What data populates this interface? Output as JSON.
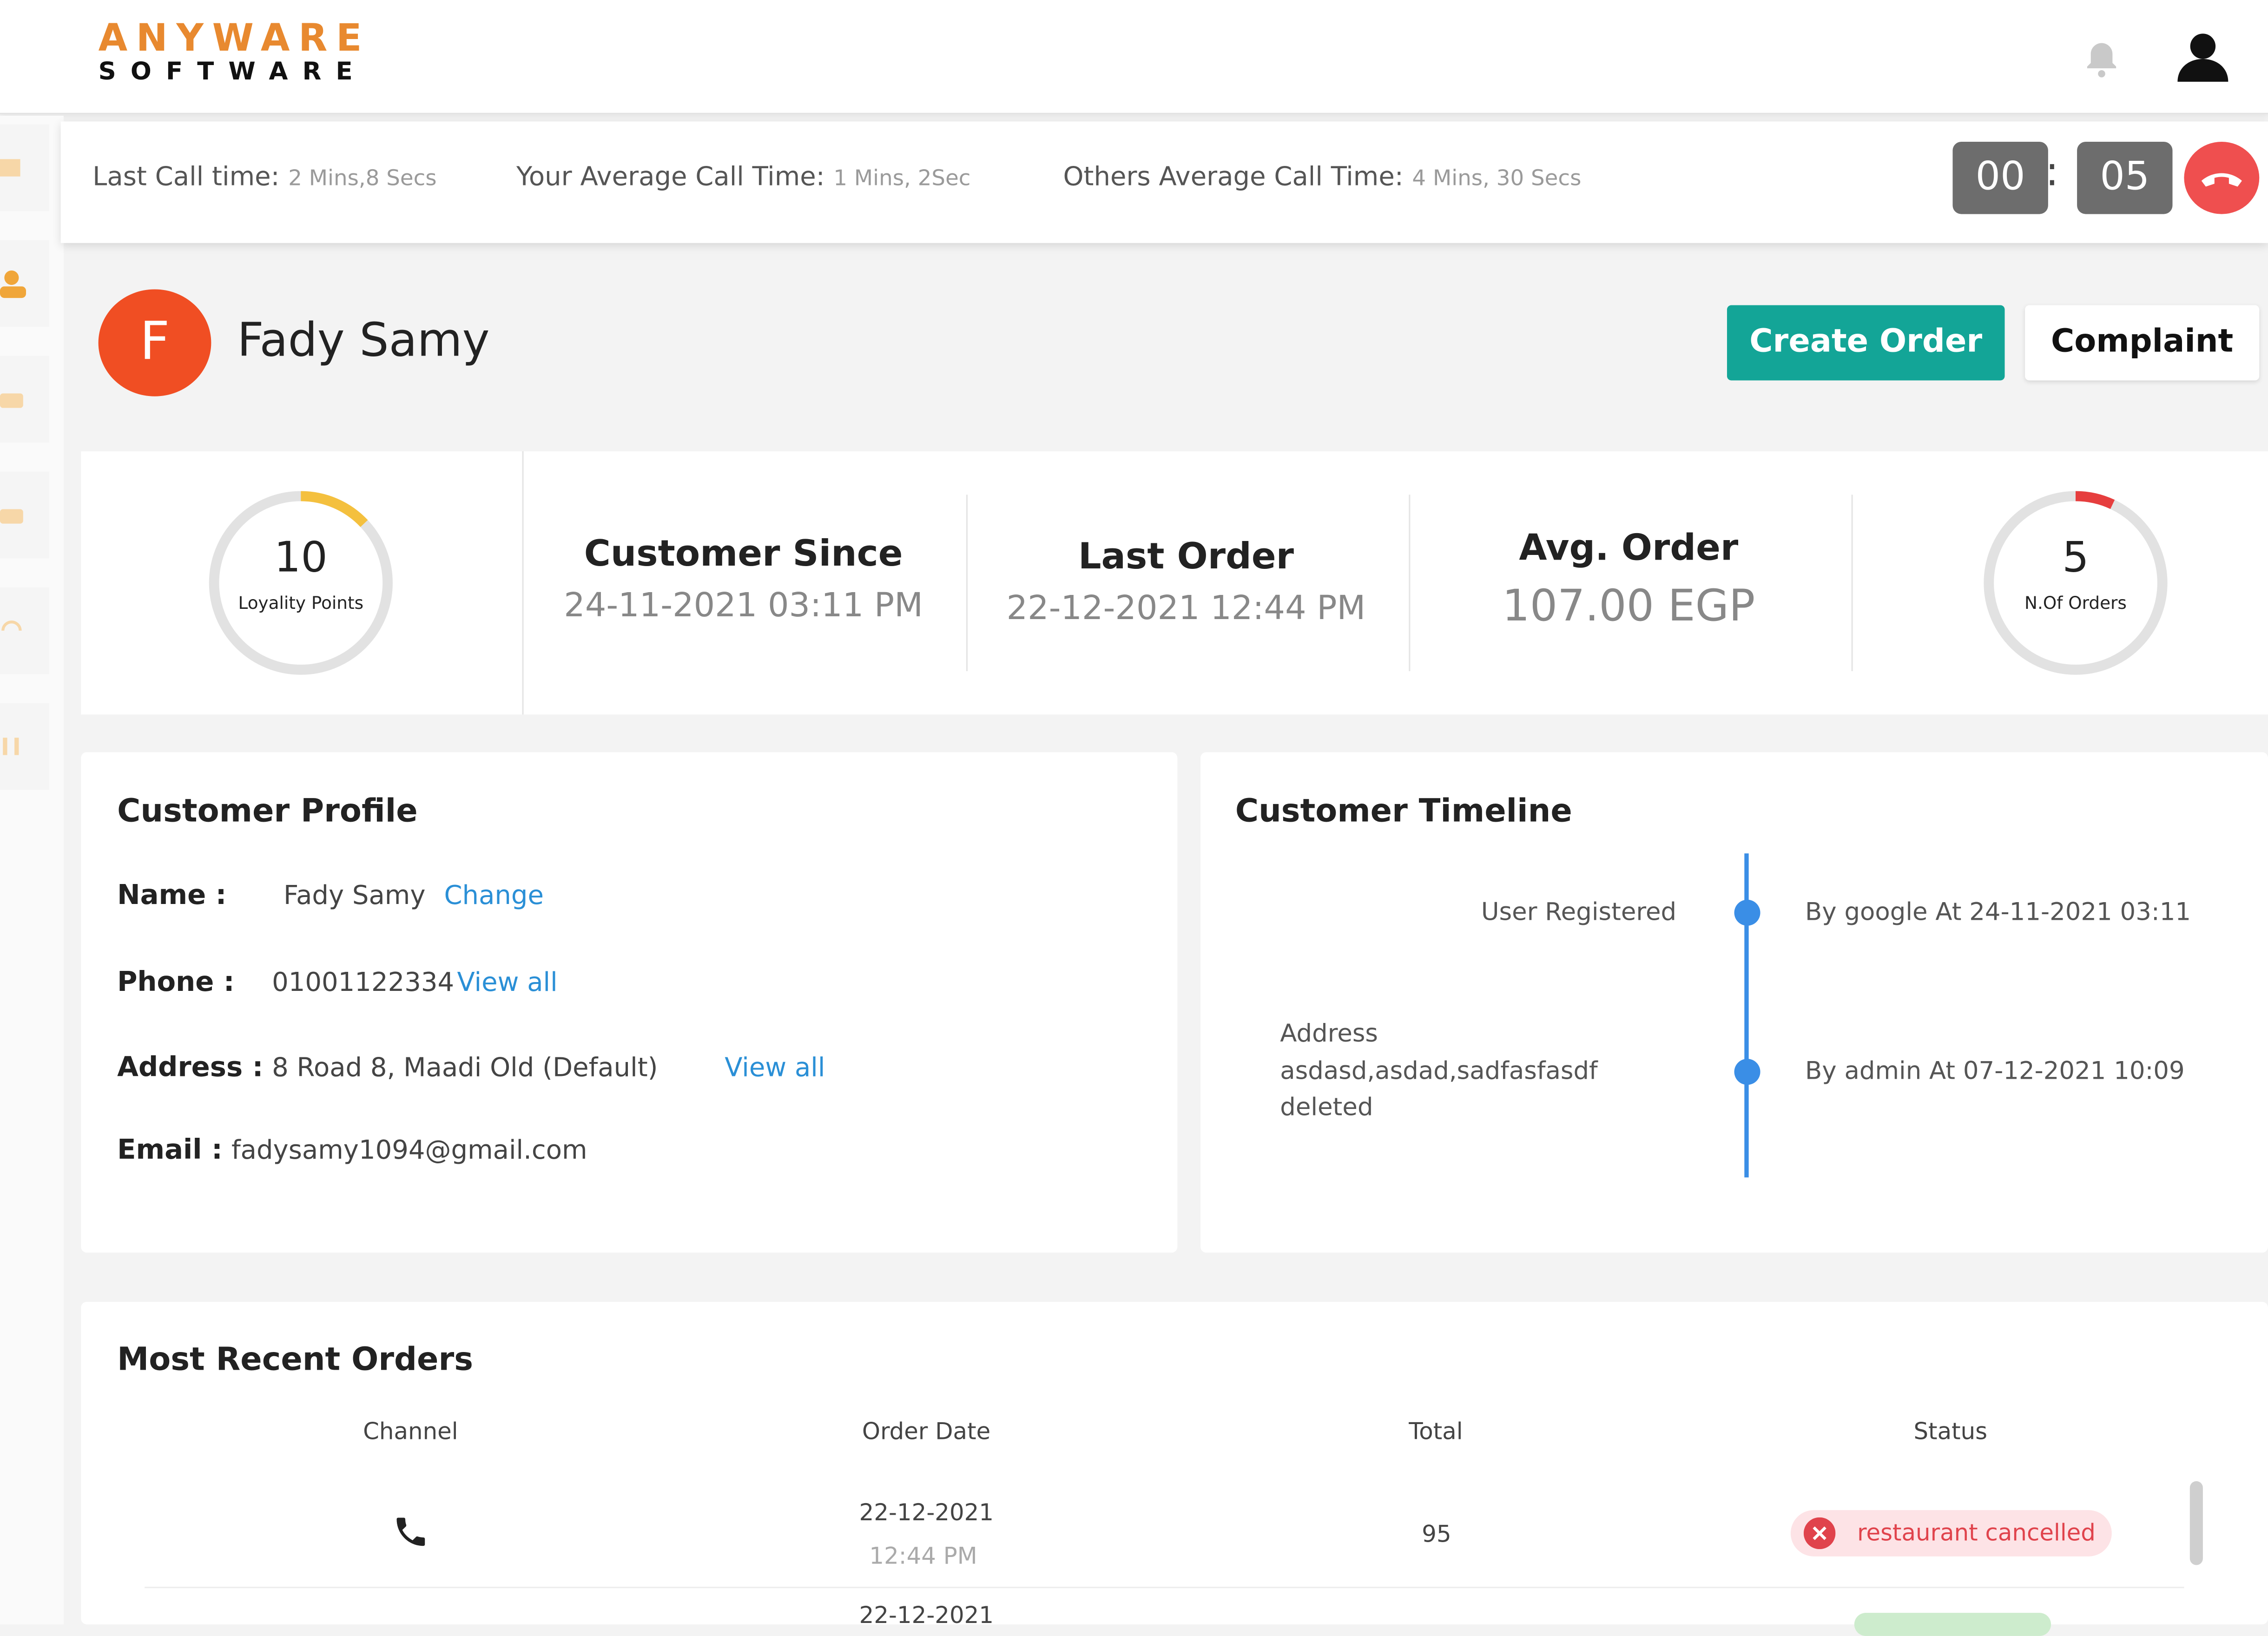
{
  "brand": {
    "line1": "ANYWARE",
    "line2": "SOFTWARE"
  },
  "callbar": {
    "last_call_label": "Last Call time:",
    "last_call_value": "2 Mins,8 Secs",
    "avg_label": "Your Average Call Time:",
    "avg_value": "1 Mins, 2Sec",
    "others_label": "Others Average Call Time:",
    "others_value": "4 Mins, 30 Secs",
    "timer_minutes": "00",
    "timer_separator": ":",
    "timer_seconds": "05"
  },
  "customer": {
    "initial": "F",
    "name": "Fady Samy"
  },
  "actions": {
    "create_order": "Create Order",
    "complaint": "Complaint"
  },
  "stats": {
    "loyalty_value": "10",
    "loyalty_label": "Loyality Points",
    "loyalty_progress": 0.13,
    "since_title": "Customer Since",
    "since_value": "24-11-2021 03:11 PM",
    "last_order_title": "Last Order",
    "last_order_value": "22-12-2021  12:44 PM",
    "avg_order_title": "Avg. Order",
    "avg_order_value": "107.00 EGP",
    "orders_value": "5",
    "orders_label": "N.Of Orders",
    "orders_progress": 0.07
  },
  "profile": {
    "title": "Customer Profile",
    "name_label": "Name :",
    "name_value": "Fady Samy",
    "name_link": "Change",
    "phone_label": "Phone :",
    "phone_value": "01001122334",
    "phone_link": "View all",
    "address_label": "Address :",
    "address_value": "8 Road 8, Maadi Old (Default)",
    "address_link": "View all",
    "email_label": "Email :",
    "email_value": "fadysamy1094@gmail.com"
  },
  "timeline": {
    "title": "Customer Timeline",
    "events": [
      {
        "event": [
          "User Registered"
        ],
        "detail": "By google At 24-11-2021 03:11"
      },
      {
        "event": [
          "Address",
          "asdasd,asdad,sadfasfasdf",
          "deleted"
        ],
        "detail": "By admin At 07-12-2021 10:09"
      }
    ]
  },
  "orders": {
    "title": "Most Recent Orders",
    "columns": [
      "Channel",
      "Order Date",
      "Total",
      "Status"
    ],
    "rows": [
      {
        "channel_icon": "phone-icon",
        "date": "22-12-2021",
        "time": "12:44 PM",
        "total": "95",
        "status": "restaurant cancelled"
      },
      {
        "date": "22-12-2021"
      }
    ]
  },
  "colors": {
    "accent_teal": "#13a597",
    "avatar": "#f04e23",
    "brand_orange": "#e8892f",
    "loyalty_arc": "#f4c03e",
    "orders_arc": "#e63e3e",
    "hangup": "#ef4f4f",
    "link": "#2a8fd6",
    "timeline": "#3a8ee6"
  }
}
